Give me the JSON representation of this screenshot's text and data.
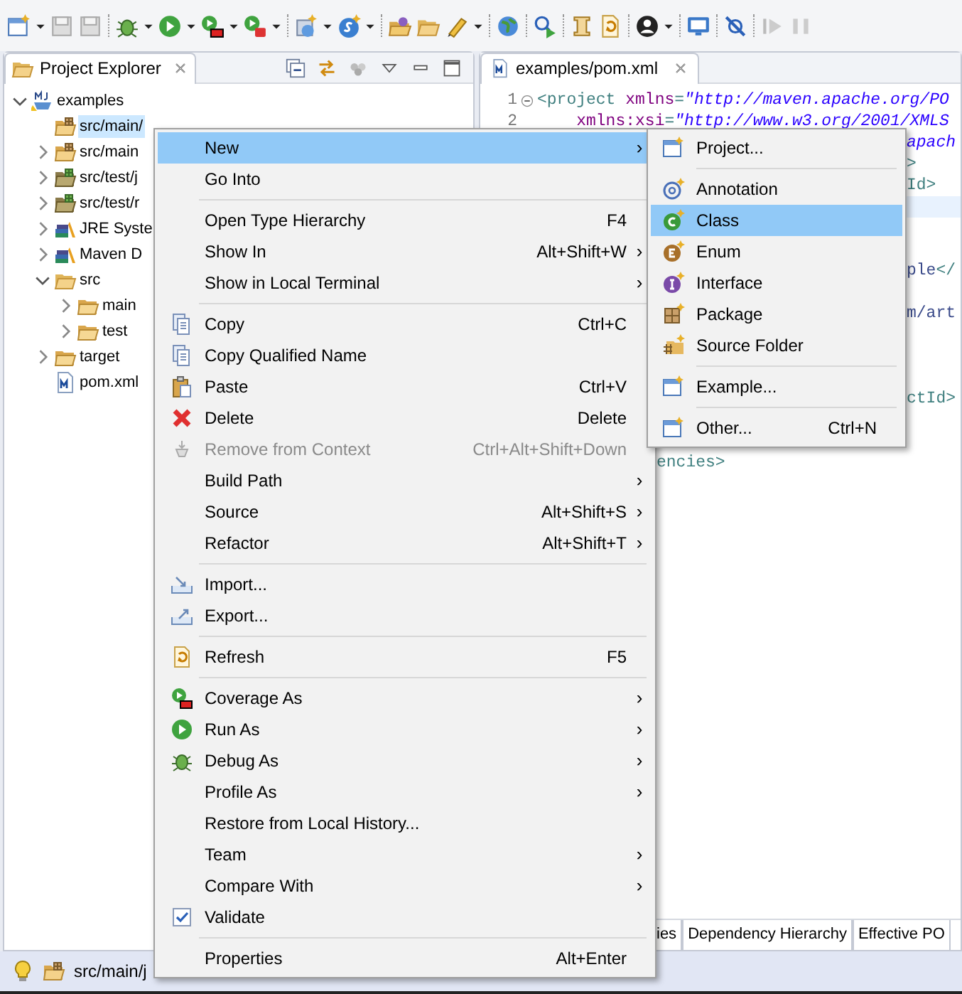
{
  "explorer": {
    "tab": {
      "label": "Project Explorer",
      "selected": true
    },
    "tree": [
      {
        "label": "examples",
        "expanded": true,
        "selected": false,
        "children": [
          {
            "label": "src/main/",
            "selected": true
          },
          {
            "label": "src/main",
            "expanded": false,
            "selected": false
          },
          {
            "label": "src/test/j",
            "expanded": false,
            "selected": false
          },
          {
            "label": "src/test/r",
            "expanded": false,
            "selected": false
          },
          {
            "label": "JRE Syste",
            "expanded": false,
            "selected": false
          },
          {
            "label": "Maven D",
            "expanded": false,
            "selected": false
          },
          {
            "label": "src",
            "expanded": true,
            "selected": false,
            "children": [
              {
                "label": "main",
                "expanded": false,
                "selected": false
              },
              {
                "label": "test",
                "expanded": false,
                "selected": false
              }
            ]
          },
          {
            "label": "target",
            "expanded": false,
            "selected": false
          },
          {
            "label": "pom.xml",
            "selected": false
          }
        ]
      }
    ]
  },
  "editor": {
    "tab": {
      "label": "examples/pom.xml",
      "selected": true
    },
    "caret_line_highlight": true,
    "lines": [
      {
        "number": "1",
        "fold": true,
        "segments": [
          {
            "kind": "tag",
            "text": "<project "
          },
          {
            "kind": "attr",
            "text": "xmlns"
          },
          {
            "kind": "tag",
            "text": "="
          },
          {
            "kind": "string",
            "text": "\"http://maven.apache.org/PO"
          }
        ]
      },
      {
        "number": "2",
        "segments": [
          {
            "kind": "attr",
            "text": "    xmlns:xsi"
          },
          {
            "kind": "tag",
            "text": "="
          },
          {
            "kind": "string",
            "text": "\"http://www.w3.org/2001/XMLS"
          }
        ]
      },
      {
        "segments": [
          {
            "kind": "string",
            "text": "apach"
          }
        ]
      },
      {
        "segments": [
          {
            "kind": "tag",
            "text": ">"
          }
        ]
      },
      {
        "segments": [
          {
            "kind": "tag",
            "text": "Id>"
          }
        ]
      },
      {
        "segments": [
          {
            "kind": "content",
            "text": "ple"
          },
          {
            "kind": "tag",
            "text": "</"
          }
        ]
      },
      {
        "segments": [
          {
            "kind": "content",
            "text": "m/art"
          }
        ]
      },
      {
        "segments": [
          {
            "kind": "tag",
            "text": "ctId>"
          }
        ]
      },
      {
        "segments": [
          {
            "kind": "tag",
            "text": "encies>"
          }
        ]
      }
    ],
    "bottom_tabs": [
      {
        "label": "ies",
        "selected": false
      },
      {
        "label": "Dependency Hierarchy",
        "selected": false
      },
      {
        "label": "Effective PO",
        "selected": false
      }
    ]
  },
  "status_bar": {
    "text": "src/main/j"
  },
  "context_menu": {
    "groups": [
      [
        {
          "label": "New",
          "arrow": "›",
          "disabled": false,
          "selected": true
        },
        {
          "label": "Go Into",
          "disabled": false,
          "selected": false
        }
      ],
      [
        {
          "label": "Open Type Hierarchy",
          "shortcut": "F4",
          "disabled": false,
          "selected": false
        },
        {
          "label": "Show In",
          "shortcut": "Alt+Shift+W",
          "arrow": "›",
          "disabled": false,
          "selected": false
        },
        {
          "label": "Show in Local Terminal",
          "arrow": "›",
          "disabled": false,
          "selected": false
        }
      ],
      [
        {
          "label": "Copy",
          "shortcut": "Ctrl+C",
          "disabled": false,
          "selected": false
        },
        {
          "label": "Copy Qualified Name",
          "disabled": false,
          "selected": false
        },
        {
          "label": "Paste",
          "shortcut": "Ctrl+V",
          "disabled": false,
          "selected": false
        },
        {
          "label": "Delete",
          "shortcut": "Delete",
          "disabled": false,
          "selected": false
        },
        {
          "label": "Remove from Context",
          "shortcut": "Ctrl+Alt+Shift+Down",
          "disabled": true,
          "selected": false
        },
        {
          "label": "Build Path",
          "arrow": "›",
          "disabled": false,
          "selected": false
        },
        {
          "label": "Source",
          "shortcut": "Alt+Shift+S",
          "arrow": "›",
          "disabled": false,
          "selected": false
        },
        {
          "label": "Refactor",
          "shortcut": "Alt+Shift+T",
          "arrow": "›",
          "disabled": false,
          "selected": false
        }
      ],
      [
        {
          "label": "Import...",
          "disabled": false,
          "selected": false
        },
        {
          "label": "Export...",
          "disabled": false,
          "selected": false
        }
      ],
      [
        {
          "label": "Refresh",
          "shortcut": "F5",
          "disabled": false,
          "selected": false
        }
      ],
      [
        {
          "label": "Coverage As",
          "arrow": "›",
          "disabled": false,
          "selected": false
        },
        {
          "label": "Run As",
          "arrow": "›",
          "disabled": false,
          "selected": false
        },
        {
          "label": "Debug As",
          "arrow": "›",
          "disabled": false,
          "selected": false
        },
        {
          "label": "Profile As",
          "arrow": "›",
          "disabled": false,
          "selected": false
        },
        {
          "label": "Restore from Local History...",
          "disabled": false,
          "selected": false
        },
        {
          "label": "Team",
          "arrow": "›",
          "disabled": false,
          "selected": false
        },
        {
          "label": "Compare With",
          "arrow": "›",
          "disabled": false,
          "selected": false
        },
        {
          "label": "Validate",
          "disabled": false,
          "selected": false
        }
      ],
      [
        {
          "label": "Properties",
          "shortcut": "Alt+Enter",
          "disabled": false,
          "selected": false
        }
      ]
    ]
  },
  "new_submenu": {
    "groups": [
      [
        {
          "label": "Project...",
          "selected": false
        }
      ],
      [
        {
          "label": "Annotation",
          "selected": false
        },
        {
          "label": "Class",
          "selected": true
        },
        {
          "label": "Enum",
          "selected": false
        },
        {
          "label": "Interface",
          "selected": false
        },
        {
          "label": "Package",
          "selected": false
        },
        {
          "label": "Source Folder",
          "selected": false
        }
      ],
      [
        {
          "label": "Example...",
          "selected": false
        }
      ],
      [
        {
          "label": "Other...",
          "shortcut": "Ctrl+N",
          "selected": false
        }
      ]
    ]
  }
}
